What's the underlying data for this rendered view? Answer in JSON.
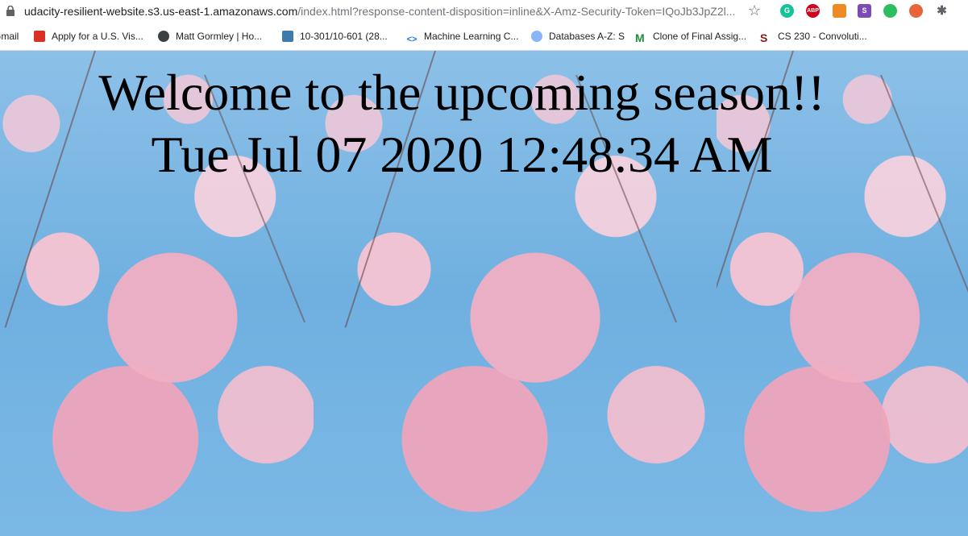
{
  "browser": {
    "url_host": "udacity-resilient-website.s3.us-east-1.amazonaws.com",
    "url_path": "/index.html?response-content-disposition=inline&X-Amz-Security-Token=IQoJb3JpZ2l...",
    "extensions": [
      {
        "icon": "grammarly-icon",
        "color": "#15c39a",
        "text": "G"
      },
      {
        "icon": "adblock-plus-icon",
        "color": "#d0021b",
        "text": "ABP"
      },
      {
        "icon": "layout-extension-icon",
        "color": "#f08a24",
        "text": ""
      },
      {
        "icon": "s-extension-icon",
        "color": "#7b4bb7",
        "text": "S"
      },
      {
        "icon": "evernote-icon",
        "color": "#2dbe60",
        "text": ""
      },
      {
        "icon": "extension-orange-icon",
        "color": "#e8643a",
        "text": ""
      },
      {
        "icon": "puzzle-extensions-icon",
        "color": "#5f6368",
        "text": ""
      }
    ]
  },
  "bookmarks": [
    {
      "label": "Gmail",
      "icon": "gmail-icon"
    },
    {
      "label": "Apply for a U.S. Vis...",
      "icon": "cgi-icon"
    },
    {
      "label": "Matt Gormley | Ho...",
      "icon": "globe-icon"
    },
    {
      "label": "10-301/10-601 (28...",
      "icon": "piazza-icon"
    },
    {
      "label": "Machine Learning C...",
      "icon": "code-icon"
    },
    {
      "label": "Databases A-Z: S",
      "icon": "cloud-icon"
    },
    {
      "label": "Clone of Final Assig...",
      "icon": "m-icon"
    },
    {
      "label": "CS 230 - Convoluti...",
      "icon": "stanford-icon"
    }
  ],
  "page": {
    "headline": "Welcome to the upcoming season!!",
    "datetime": "Tue Jul 07 2020 12:48:34 AM"
  }
}
